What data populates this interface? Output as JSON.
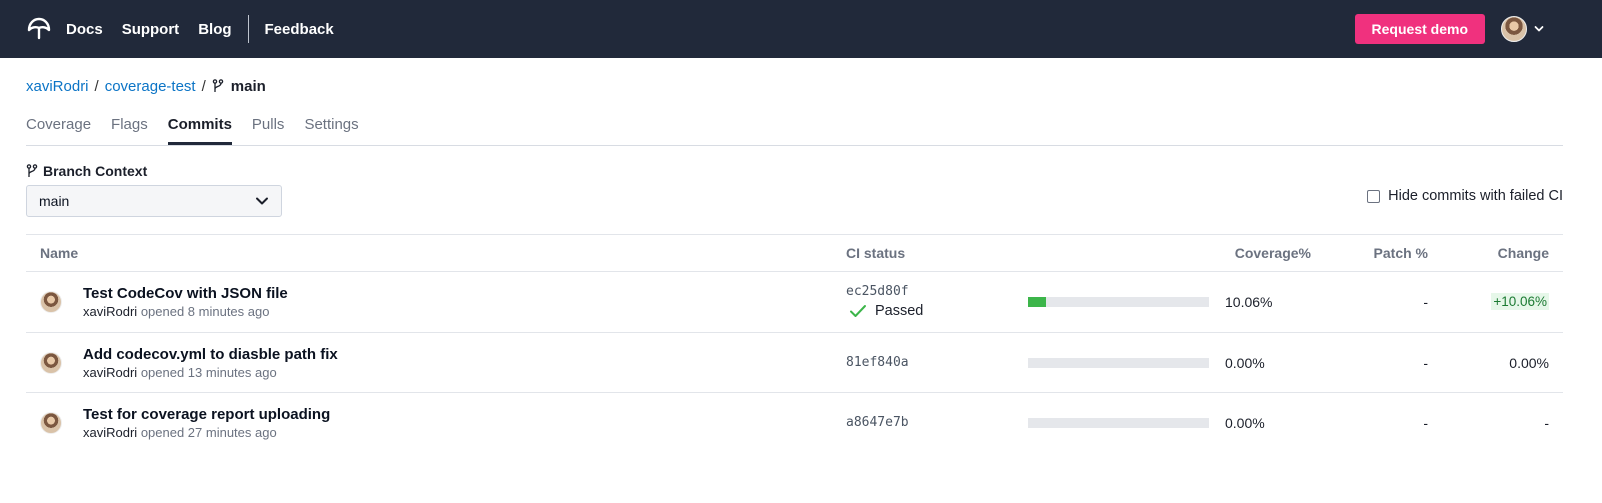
{
  "nav": {
    "links": [
      "Docs",
      "Support",
      "Blog"
    ],
    "feedback": "Feedback",
    "request_demo": "Request demo",
    "brand_color": "#f0317e",
    "bar_color": "#21293a"
  },
  "breadcrumb": {
    "owner": "xaviRodri",
    "repo": "coverage-test",
    "branch": "main"
  },
  "tabs": [
    {
      "label": "Coverage",
      "active": false
    },
    {
      "label": "Flags",
      "active": false
    },
    {
      "label": "Commits",
      "active": true
    },
    {
      "label": "Pulls",
      "active": false
    },
    {
      "label": "Settings",
      "active": false
    }
  ],
  "branch_context": {
    "label": "Branch Context",
    "selected": "main",
    "hide_failed_label": "Hide commits with failed CI",
    "hide_failed_checked": false
  },
  "table": {
    "headers": {
      "name": "Name",
      "ci": "CI status",
      "coverage": "Coverage%",
      "patch": "Patch %",
      "change": "Change"
    },
    "rows": [
      {
        "title": "Test CodeCov with JSON file",
        "author": "xaviRodri",
        "meta": "opened 8 minutes ago",
        "sha": "ec25d80f",
        "ci_status": "Passed",
        "coverage": "10.06%",
        "coverage_fraction": 0.1006,
        "patch": "-",
        "change": "+10.06%"
      },
      {
        "title": "Add codecov.yml to diasble path fix",
        "author": "xaviRodri",
        "meta": "opened 13 minutes ago",
        "sha": "81ef840a",
        "ci_status": "",
        "coverage": "0.00%",
        "coverage_fraction": 0,
        "patch": "-",
        "change": "0.00%"
      },
      {
        "title": "Test for coverage report uploading",
        "author": "xaviRodri",
        "meta": "opened 27 minutes ago",
        "sha": "a8647e7b",
        "ci_status": "",
        "coverage": "0.00%",
        "coverage_fraction": 0,
        "patch": "-",
        "change": "-"
      }
    ]
  }
}
